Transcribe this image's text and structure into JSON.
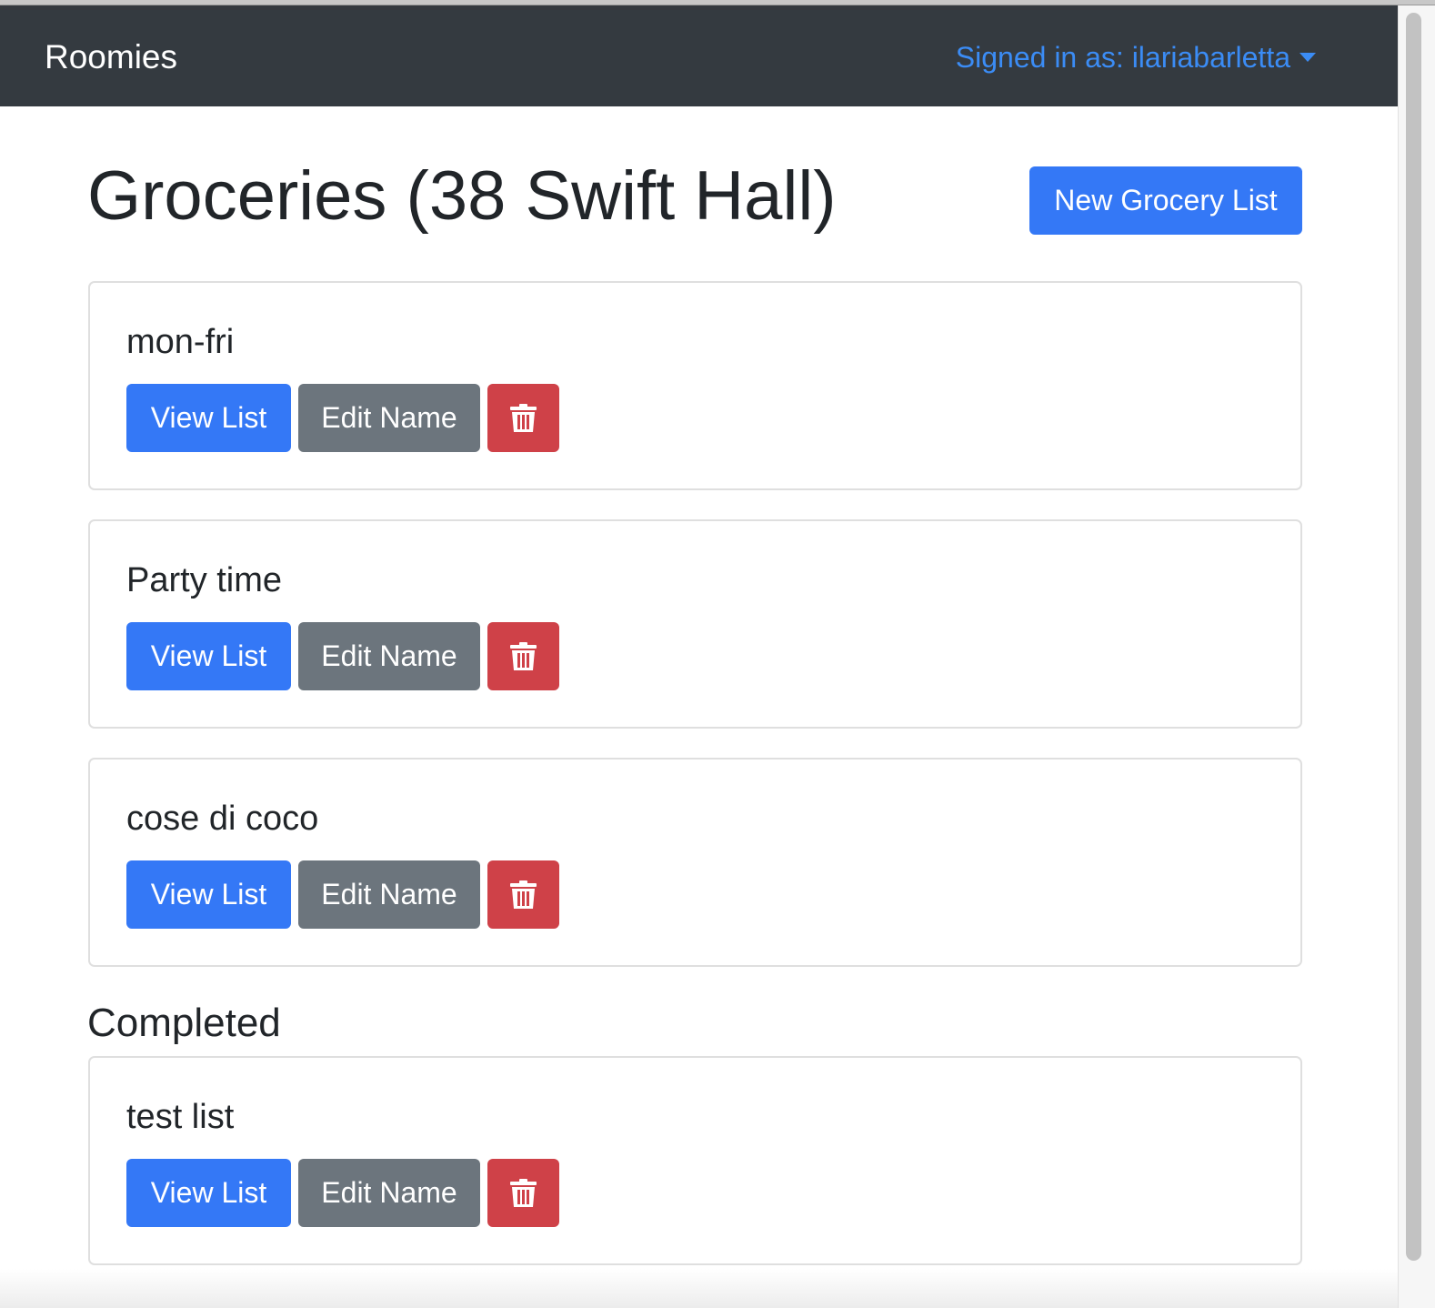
{
  "navbar": {
    "brand": "Roomies",
    "user_menu": "Signed in as: ilariabarletta"
  },
  "page": {
    "title": "Groceries (38 Swift Hall)",
    "new_list_button": "New Grocery List"
  },
  "lists": [
    {
      "name": "mon-fri",
      "view_label": "View List",
      "edit_label": "Edit Name",
      "delete_icon": "trash-icon"
    },
    {
      "name": "Party time",
      "view_label": "View List",
      "edit_label": "Edit Name",
      "delete_icon": "trash-icon"
    },
    {
      "name": "cose di coco",
      "view_label": "View List",
      "edit_label": "Edit Name",
      "delete_icon": "trash-icon"
    }
  ],
  "completed": {
    "heading": "Completed",
    "lists": [
      {
        "name": "test list",
        "view_label": "View List",
        "edit_label": "Edit Name",
        "delete_icon": "trash-icon"
      }
    ]
  },
  "colors": {
    "navbar_bg": "#343a40",
    "primary": "#3478f6",
    "secondary": "#6c757d",
    "danger": "#cf4148",
    "link": "#3b8cf5"
  }
}
